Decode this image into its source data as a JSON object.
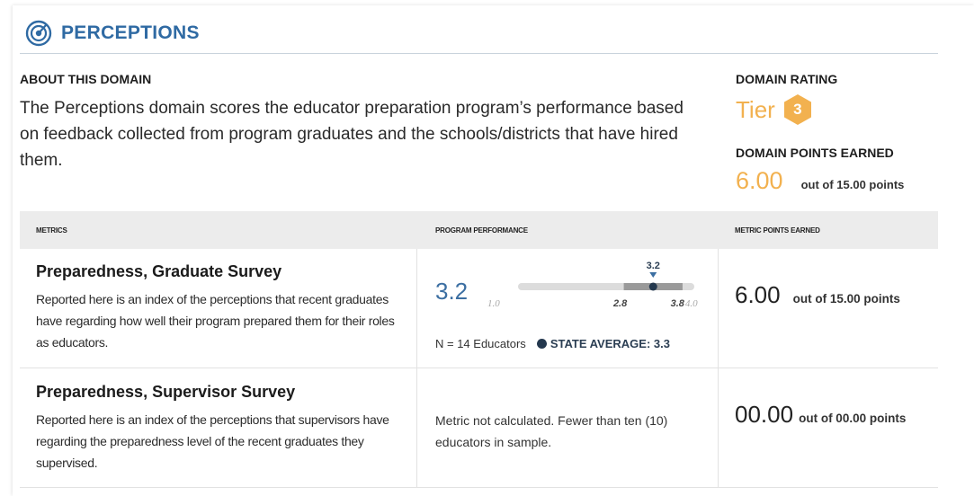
{
  "header": {
    "title": "PERCEPTIONS",
    "icon": "target-icon",
    "accent": "#2f6aa3"
  },
  "about": {
    "label": "ABOUT THIS DOMAIN",
    "text": "The Perceptions domain scores the educator preparation program’s performance based on feedback collected from program graduates and the schools/districts that have hired them."
  },
  "rating": {
    "label": "DOMAIN RATING",
    "tier_text": "Tier",
    "tier_number": "3",
    "color": "#f2b14f"
  },
  "points": {
    "label": "DOMAIN POINTS EARNED",
    "value": "6.00",
    "out_of": "out of 15.00 points"
  },
  "table": {
    "headers": [
      "METRICS",
      "PROGRAM PERFORMANCE",
      "METRIC POINTS EARNED"
    ],
    "rows": [
      {
        "title": "Preparedness, Graduate Survey",
        "description": "Reported here is an index of the perceptions that recent graduates have regarding how well their program prepared them for their roles as educators.",
        "value": "3.2",
        "scale": {
          "min_label": "1.0",
          "max_label": "4.0",
          "marker_label": "3.2",
          "range_low_label": "2.8",
          "range_high_label": "3.8",
          "min": 1.0,
          "max": 4.0,
          "marker": 3.2,
          "range_low": 2.8,
          "range_high": 3.8,
          "state_avg": 3.3
        },
        "n_text": "N = 14 Educators",
        "state_avg_text": "STATE AVERAGE: 3.3",
        "earned": "6.00",
        "earned_out": "out of 15.00 points"
      },
      {
        "title": "Preparedness, Supervisor Survey",
        "description": "Reported here is an index of the perceptions that supervisors have regarding the preparedness level of the recent graduates they supervised.",
        "not_calculated": "Metric not calculated. Fewer than ten (10) educators in sample.",
        "earned": "00.00",
        "earned_out": "out of 00.00 points"
      }
    ]
  }
}
